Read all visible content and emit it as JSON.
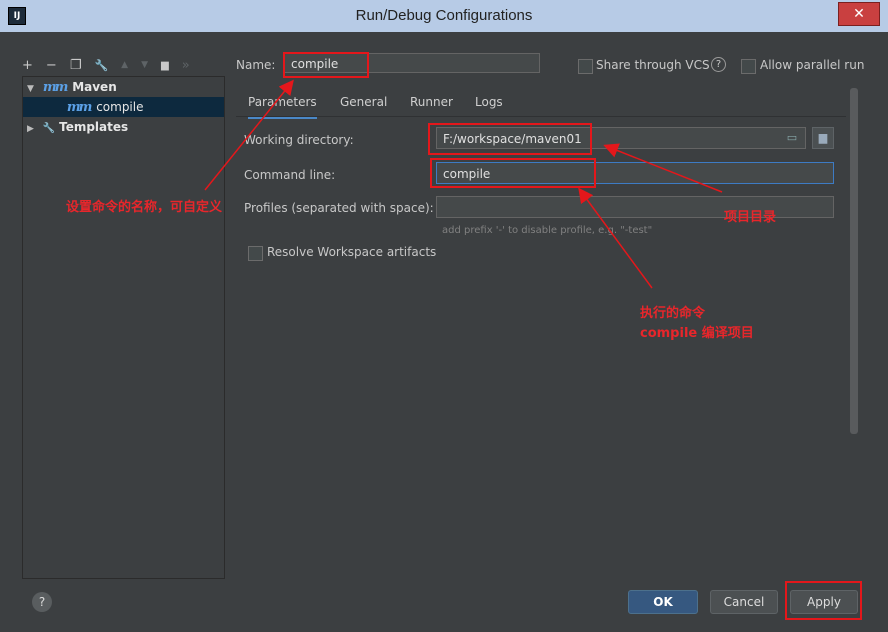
{
  "window": {
    "title": "Run/Debug Configurations",
    "app_icon": "IJ",
    "close_glyph": "✕"
  },
  "toolbar": {
    "add": "+",
    "remove": "−",
    "copy": "❐",
    "edit_defaults": "🔧",
    "move_up": "▲",
    "move_down": "▼",
    "folder": "▆",
    "more": "»"
  },
  "tree": {
    "items": [
      {
        "label": "Maven",
        "icon": "m-icon"
      },
      {
        "label": "compile",
        "icon": "m-icon"
      },
      {
        "label": "Templates",
        "icon": "wrench-icon"
      }
    ],
    "maven_icon_glyph": "m",
    "compile_icon_glyph": "m",
    "wrench_glyph": "🔧"
  },
  "name_row": {
    "label": "Name:",
    "value": "compile",
    "share_label": "Share through VCS",
    "help_glyph": "?",
    "parallel_label": "Allow parallel run"
  },
  "tabs": [
    "Parameters",
    "General",
    "Runner",
    "Logs"
  ],
  "form": {
    "working_dir_label": "Working directory:",
    "working_dir_value": "F:/workspace/maven01",
    "command_line_label": "Command line:",
    "command_line_value": "compile",
    "profiles_label": "Profiles (separated with space):",
    "profiles_value": "",
    "profiles_hint": "add prefix '-' to disable profile, e.g. \"-test\"",
    "resolve_label": "Resolve Workspace artifacts"
  },
  "footer": {
    "help_glyph": "?",
    "ok_label": "OK",
    "cancel_label": "Cancel",
    "apply_label": "Apply"
  },
  "annotations": {
    "name_note": "设置命令的名称，可自定义",
    "dir_note": "项目目录",
    "cmd_note_line1": "执行的命令",
    "cmd_note_line2": "compile 编译项目"
  },
  "colors": {
    "accent": "#4a88c7",
    "annotation_red": "#e4171b",
    "background": "#3c3f41",
    "selection": "#0d293e"
  }
}
